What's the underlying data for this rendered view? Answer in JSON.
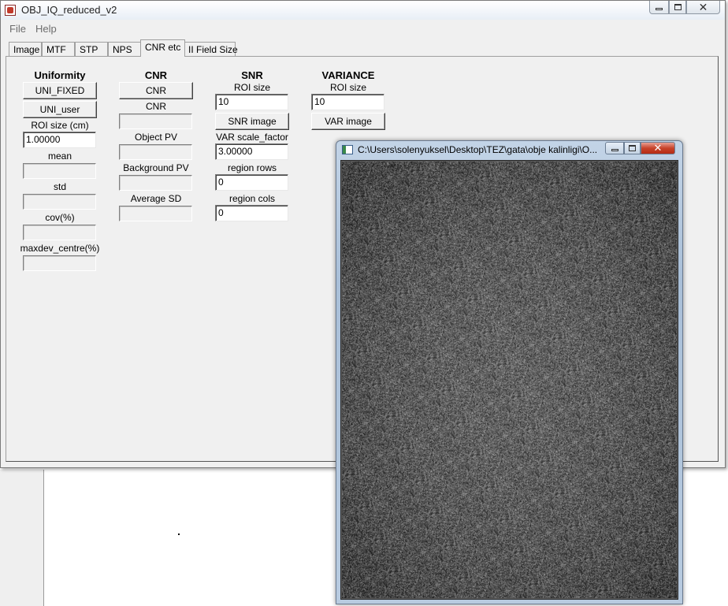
{
  "main_window": {
    "title": "OBJ_IQ_reduced_v2"
  },
  "menu": {
    "items": [
      "File",
      "Help"
    ]
  },
  "tabs": [
    {
      "label": "Image",
      "active": false
    },
    {
      "label": "MTF",
      "active": false
    },
    {
      "label": "STP",
      "active": false
    },
    {
      "label": "NPS",
      "active": false
    },
    {
      "label": "CNR etc",
      "active": true
    },
    {
      "label": "II Field Size",
      "active": false
    }
  ],
  "uniformity": {
    "heading": "Uniformity",
    "uni_fixed_button": "UNI_FIXED",
    "uni_user_button": "UNI_user",
    "roi_size_label": "ROI size (cm)",
    "roi_size_value": "1.00000",
    "mean_label": "mean",
    "mean_value": "",
    "std_label": "std",
    "std_value": "",
    "cov_label": "cov(%)",
    "cov_value": "",
    "maxdev_label": "maxdev_centre(%)",
    "maxdev_value": ""
  },
  "cnr": {
    "heading": "CNR",
    "cnr_button": "CNR",
    "cnr_label": "CNR",
    "cnr_value": "",
    "object_pv_label": "Object PV",
    "object_pv_value": "",
    "background_pv_label": "Background PV",
    "background_pv_value": "",
    "average_sd_label": "Average SD",
    "average_sd_value": ""
  },
  "snr": {
    "heading": "SNR",
    "roi_size_label": "ROI size",
    "roi_size_value": "10",
    "snr_image_button": "SNR image",
    "var_scale_label": "VAR scale_factor",
    "var_scale_value": "3.00000",
    "region_rows_label": "region rows",
    "region_rows_value": "0",
    "region_cols_label": "region cols",
    "region_cols_value": "0"
  },
  "variance": {
    "heading": "VARIANCE",
    "roi_size_label": "ROI size",
    "roi_size_value": "10",
    "var_image_button": "VAR image"
  },
  "figure_window": {
    "title": "C:\\Users\\solenyuksel\\Desktop\\TEZ\\gata\\obje kalinligi\\O..."
  }
}
